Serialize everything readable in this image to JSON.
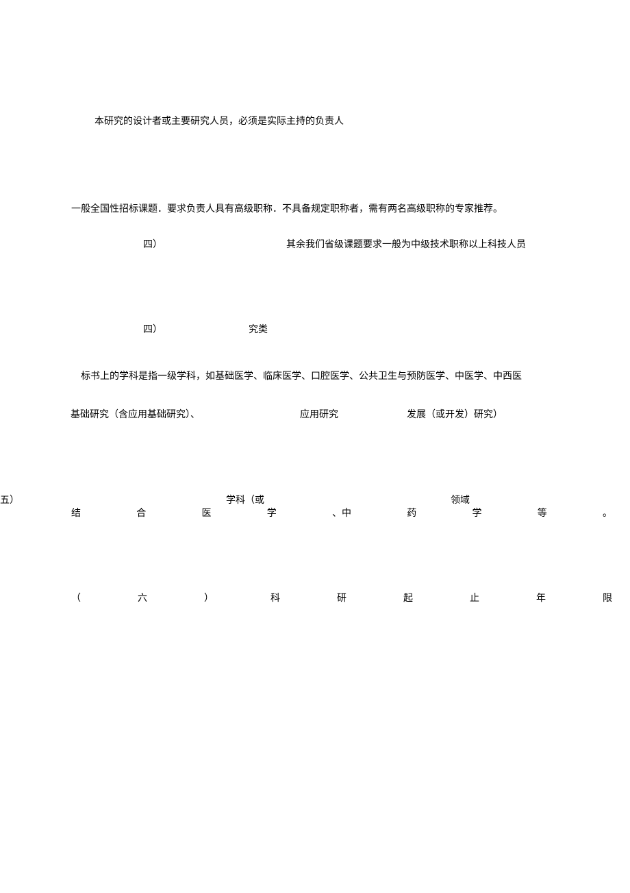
{
  "line1": "本研究的设计者或主要研究人员，必须是实际主持的负责人",
  "line2": "一般全国性招标课题．要求负责人具有高级职称．不具备规定职称者，需有两名高级职称的专家推荐。",
  "line3a": "四）",
  "line3b": "其余我们省级课题要求一般为中级技术职称以上科技人员",
  "line4a": "四）",
  "line4b": "究类",
  "line5": "标书上的学科是指一级学科，如基础医学、临床医学、口腔医学、公共卫生与预防医学、中医学、中西医",
  "line6a": "基础研究（含应用基础研究）、",
  "line6b": "应用研究",
  "line6c": "发展（或开发）研究）",
  "row1_left": "五）",
  "row1_mid1": "学科（或",
  "row1_mid2": "领域",
  "row1_c1": "结",
  "row1_c2": "合",
  "row1_c3": "医",
  "row1_c4": "学",
  "row1_c5": "、中",
  "row1_c6": "药",
  "row1_c7": "学",
  "row1_c8": "等",
  "row1_c9": "。",
  "row2_c1": "（",
  "row2_c2": "六",
  "row2_c3": "）",
  "row2_c4": "科",
  "row2_c5": "研",
  "row2_c6": "起",
  "row2_c7": "止",
  "row2_c8": "年",
  "row2_c9": "限"
}
